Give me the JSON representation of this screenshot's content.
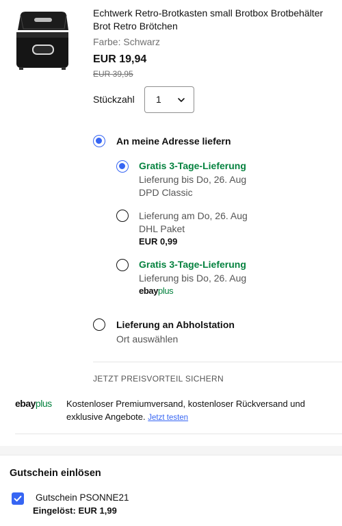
{
  "product": {
    "title": "Echtwerk Retro-Brotkasten small Brotbox Brotbehälter Brot Retro Brötchen",
    "variant": "Farbe: Schwarz",
    "price": "EUR 19,94",
    "original_price": "EUR 39,95",
    "image_icon": "black-breadbox-image"
  },
  "quantity": {
    "label": "Stückzahl",
    "value": "1"
  },
  "delivery": {
    "home": {
      "label": "An meine Adresse liefern",
      "selected": true,
      "options": [
        {
          "title": "Gratis 3-Tage-Lieferung",
          "title_style": "green",
          "line1": "Lieferung bis Do, 26. Aug",
          "line2": "DPD Classic",
          "selected": true
        },
        {
          "title": "Lieferung am Do, 26. Aug",
          "title_style": "regular",
          "line1": "DHL Paket",
          "line2": "EUR 0,99",
          "selected": false
        },
        {
          "title": "Gratis 3-Tage-Lieferung",
          "title_style": "green",
          "line1": "Lieferung bis Do, 26. Aug",
          "badge_ebay": "ebay",
          "badge_plus": "plus",
          "selected": false
        }
      ]
    },
    "pickup": {
      "label": "Lieferung an Abholstation",
      "sublabel": "Ort auswählen",
      "selected": false
    }
  },
  "promo": {
    "caption": "JETZT PREISVORTEIL SICHERN",
    "logo_ebay": "ebay",
    "logo_plus": "plus",
    "text": "Kostenloser Premiumversand, kostenloser Rückversand und exklusive Angebote.",
    "link": "Jetzt testen"
  },
  "coupon": {
    "heading": "Gutschein einlösen",
    "code_label": "Gutschein PSONNE21",
    "redeemed": "Eingelöst: EUR 1,99",
    "checked": true
  },
  "colors": {
    "accent_blue": "#3665f3",
    "green": "#05823f",
    "muted": "#707070"
  }
}
